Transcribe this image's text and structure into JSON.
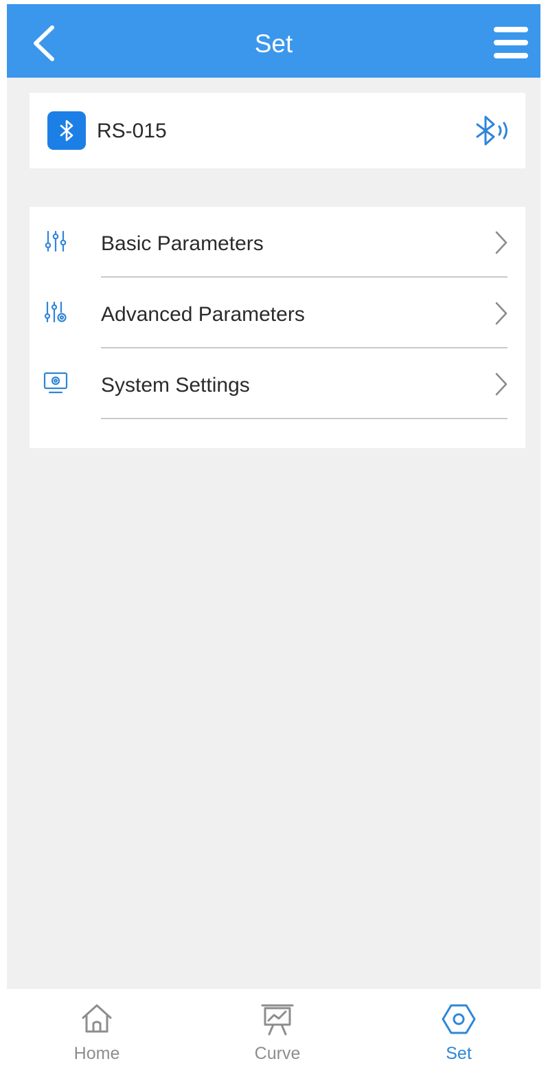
{
  "header": {
    "title": "Set"
  },
  "device": {
    "name": "RS-015"
  },
  "menu": {
    "items": [
      {
        "label": "Basic Parameters",
        "icon": "sliders-icon"
      },
      {
        "label": "Advanced Parameters",
        "icon": "sliders-gear-icon"
      },
      {
        "label": "System Settings",
        "icon": "monitor-gear-icon"
      }
    ]
  },
  "tabs": [
    {
      "label": "Home",
      "icon": "home-icon",
      "active": false
    },
    {
      "label": "Curve",
      "icon": "chart-board-icon",
      "active": false
    },
    {
      "label": "Set",
      "icon": "hex-gear-icon",
      "active": true
    }
  ],
  "colors": {
    "header_bg": "#3a97ec",
    "accent": "#2e86d8",
    "badge_bg": "#1c7fe6",
    "page_bg": "#f0f0f1",
    "inactive": "#8d8d8d"
  }
}
